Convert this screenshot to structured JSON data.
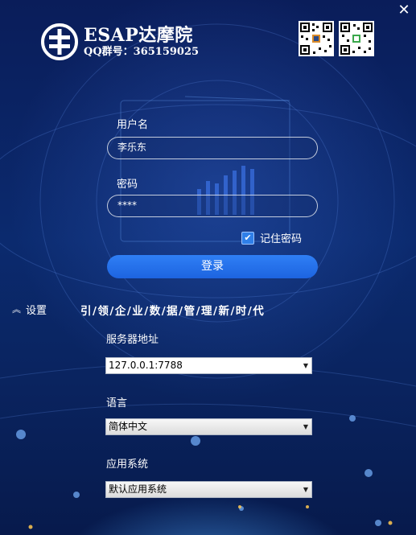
{
  "window": {
    "close_icon": "close-icon"
  },
  "logo": {
    "title": "ESAP达摩院",
    "qq": "QQ群号：365159025"
  },
  "login": {
    "username_label": "用户名",
    "username_value": "李乐东",
    "password_label": "密码",
    "password_value": "****",
    "remember_label": "记住密码",
    "remember_checked": true,
    "login_button": "登录"
  },
  "settings": {
    "toggle_label": "设置",
    "slogan": "引/领/企/业/数/据/管/理/新/时/代",
    "server_label": "服务器地址",
    "server_value": "127.0.0.1:7788",
    "language_label": "语言",
    "language_value": "简体中文",
    "app_label": "应用系统",
    "app_value": "默认应用系统"
  },
  "colors": {
    "accent": "#1d64e0",
    "background": "#0b2a6e"
  }
}
